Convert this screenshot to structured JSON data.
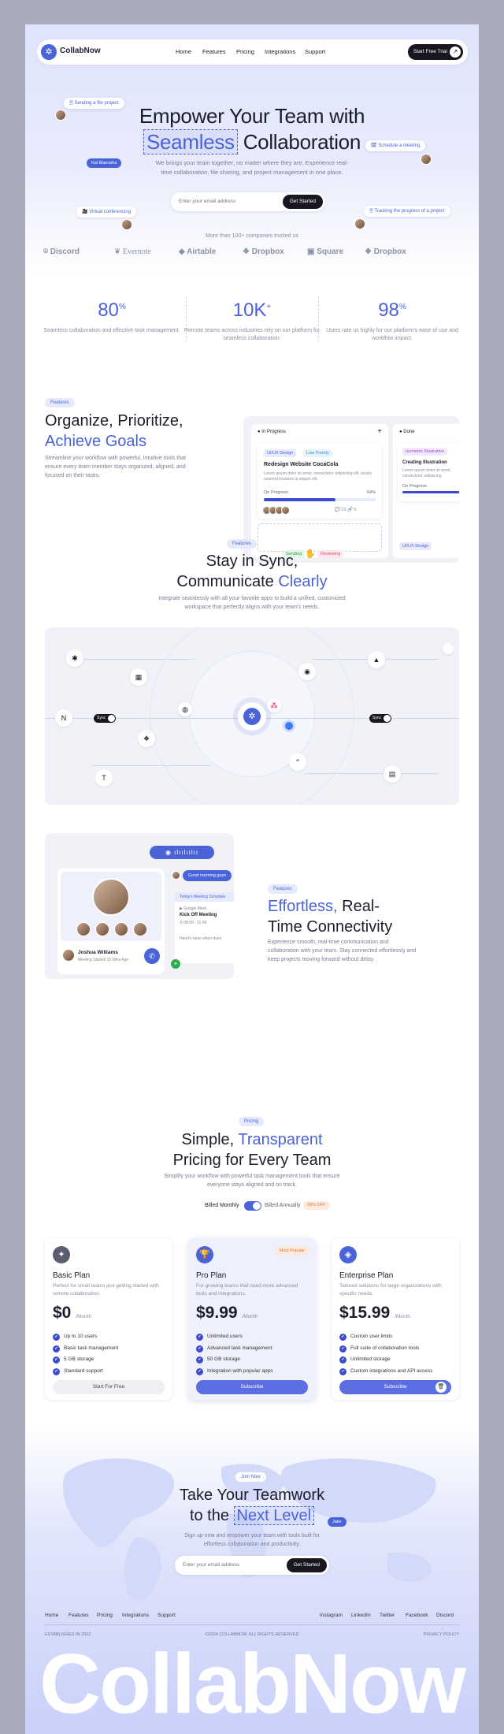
{
  "nav": {
    "logo": "CollabNow",
    "links": [
      "Home",
      "Features",
      "Pricing",
      "Integrations",
      "Support"
    ],
    "cta": "Start Free Trial"
  },
  "hero": {
    "title1": "Empower Your Team with",
    "title_highlight": "Seamless",
    "title2": "Collaboration",
    "subtitle": "We brings your team together, no matter where they are. Experience real-time collaboration, file sharing, and project management in one place.",
    "email_placeholder": "Enter your email address",
    "button": "Get Started",
    "pill_file": "Sending a file project",
    "pill_schedule": "Schedule a meeting",
    "pill_video": "Virtual conferencing",
    "pill_tracking": "Tracking the progress of a project",
    "tag_name": "Kat Manosha"
  },
  "trusted": {
    "text": "More than 100+ companies trusted us",
    "brands": [
      "Discord",
      "Evernote",
      "Airtable",
      "Dropbox",
      "Square",
      "Dropbox"
    ]
  },
  "stats": [
    {
      "value": "80",
      "suffix": "%",
      "desc": "Seamless collaboration and effective task management."
    },
    {
      "value": "10K",
      "suffix": "+",
      "desc": "Remote teams across industries rely on our platform for seamless collaboration."
    },
    {
      "value": "98",
      "suffix": "%",
      "desc": "Users rate us highly for our platform's ease of use and workflow impact."
    }
  ],
  "features": {
    "badge": "Features",
    "title1": "Organize, Prioritize,",
    "title_highlight": "Achieve Goals",
    "desc": "Streamline your workflow with powerful, intuitive tools that ensure every team member stays organized, aligned, and focused on their tasks.",
    "col1": "In Progress",
    "col2": "Done",
    "card_tag1": "UI/UX Design",
    "card_tag2": "Low Priority",
    "card_title": "Redesign Website CocaCola",
    "card_desc": "Lorem ipsum dolor sit amet, consectetur adipiscing elit, iaculis ruismod tincidunt ut aliquet elit.",
    "card_status": "On Progress",
    "card_pct": "64%",
    "card_comments": "22",
    "card_links": "0",
    "done_tag": "Isometric Illustration",
    "done_title": "Creating Illustration",
    "done_desc": "Lorem ipsum dolor sit amet, consectetur adipiscing",
    "done_status": "On Progress",
    "done_tag2": "UI/UX Design",
    "label_sending": "Sending",
    "label_reviewing": "Reviewing"
  },
  "sync": {
    "badge": "Features",
    "title1": "Stay in Sync,",
    "title2": "Communicate",
    "title_highlight": "Clearly",
    "desc": "Integrate seamlessly with all your favorite apps to build a unified, customized workspace that perfectly aligns with your team's needs.",
    "toggle": "Sync"
  },
  "connect": {
    "badge": "Features",
    "title_highlight": "Effortless,",
    "title1": "Real-",
    "title2": "Time Connectivity",
    "desc": "Experience smooth, real-time communication and collaboration with your team. Stay connected effortlessly and keep projects moving forward without delay.",
    "chat_msg": "Good morning guys",
    "schedule_title": "Today's Meeting Schedule",
    "meet_app": "Google Meet",
    "meet_title": "Kick Off Meeting",
    "meet_time": "08:00 - 11:00",
    "meet_note": "Hand's raise when dues",
    "caller": "Joshua Williams",
    "caller_sub": "Meeting Started 10 Mins Ago"
  },
  "pricing": {
    "badge": "Pricing",
    "title1": "Simple,",
    "title_highlight": "Transparent",
    "title2": "Pricing for Every Team",
    "desc": "Simplify your workflow with powerful task management tools that ensure everyone stays aligned and on track.",
    "monthly": "Billed Monthly",
    "annually": "Billed Annually",
    "off": "20% OFF",
    "plans": [
      {
        "name": "Basic Plan",
        "desc": "Perfect for small teams just getting started with remote collaboration.",
        "price": "$0",
        "period": "/Month",
        "features": [
          "Up to 10 users",
          "Basic task management",
          "5 GB storage",
          "Standard support"
        ],
        "cta": "Start For Free"
      },
      {
        "name": "Pro Plan",
        "badge": "Most Popular",
        "desc": "For growing teams that need more advanced tools and integrations.",
        "price": "$9.99",
        "period": "/Month",
        "features": [
          "Unlimited users",
          "Advanced task management",
          "50 GB storage",
          "Integration with popular apps"
        ],
        "cta": "Subscribe"
      },
      {
        "name": "Enterprise Plan",
        "desc": "Tailored solutions for large organizations with specific needs.",
        "price": "$15.99",
        "period": "/Month",
        "features": [
          "Custom user limits",
          "Full suite of collaboration tools",
          "Unlimited storage",
          "Custom integrations and API access"
        ],
        "cta": "Subscribe"
      }
    ]
  },
  "cta": {
    "badge": "Join Now",
    "title1": "Take Your Teamwork",
    "title2": "to the",
    "title_highlight": "Next Level",
    "tag": "Jake",
    "desc": "Sign up now and empower your team with tools built for effortless collaboration and productivity.",
    "email_placeholder": "Enter your email address",
    "button": "Get Started"
  },
  "footer": {
    "links": [
      "Home",
      "Features",
      "Pricing",
      "Integrations",
      "Support"
    ],
    "social": [
      "Instagram",
      "LinkedIn",
      "Twitter",
      "Facebook",
      "Discord"
    ],
    "established": "ESTABLISHED IN 2022",
    "copyright": "©2024 COLLABNOW. ALL RIGHTS RESERVED",
    "privacy": "PRIVACY POLICY",
    "wordmark": "CollabNow"
  },
  "colors": {
    "accent": "#4a63d9",
    "dark": "#16171f",
    "page_bg": "#a9abbc"
  }
}
